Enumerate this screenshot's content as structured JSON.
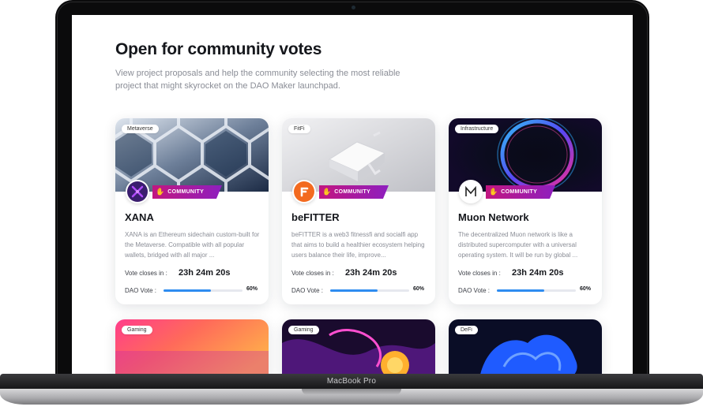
{
  "device": {
    "label": "MacBook Pro"
  },
  "header": {
    "title": "Open for community votes",
    "subtitle": "View project proposals and help the community selecting the most reliable project that might skyrocket on the DAO Maker launchpad."
  },
  "colors": {
    "community_badge": "#c21680",
    "progress": "#2e8cf0",
    "hand_icon": "#f7a21b"
  },
  "cards": [
    {
      "tag": "Metaverse",
      "badge": "COMMUNITY",
      "name": "XANA",
      "description": "XANA is an Ethereum sidechain custom-built for the Metaverse. Compatible with all popular wallets, bridged with all major ...",
      "closes_label": "Vote closes in :",
      "closes_value": "23h 24m 20s",
      "vote_label": "DAO Vote :",
      "vote_percent_text": "60%",
      "vote_fraction": 0.6,
      "logo_icon": "xana-logo-icon"
    },
    {
      "tag": "FitFi",
      "badge": "COMMUNITY",
      "name": "beFITTER",
      "description": "beFITTER is a web3 fitnessfi and socialfi app that aims to build a healthier ecosystem helping users balance their life, improve...",
      "closes_label": "Vote closes in :",
      "closes_value": "23h 24m 20s",
      "vote_label": "DAO Vote :",
      "vote_percent_text": "60%",
      "vote_fraction": 0.6,
      "logo_icon": "befitter-logo-icon"
    },
    {
      "tag": "Infrastructure",
      "badge": "COMMUNITY",
      "name": "Muon Network",
      "description": "The decentralized Muon network is like a distributed supercomputer with a universal operating system. It will be run by global ...",
      "closes_label": "Vote closes in :",
      "closes_value": "23h 24m 20s",
      "vote_label": "DAO Vote :",
      "vote_percent_text": "60%",
      "vote_fraction": 0.6,
      "logo_icon": "muon-logo-icon"
    },
    {
      "tag": "Gaming"
    },
    {
      "tag": "Gaming"
    },
    {
      "tag": "DeFi"
    }
  ]
}
